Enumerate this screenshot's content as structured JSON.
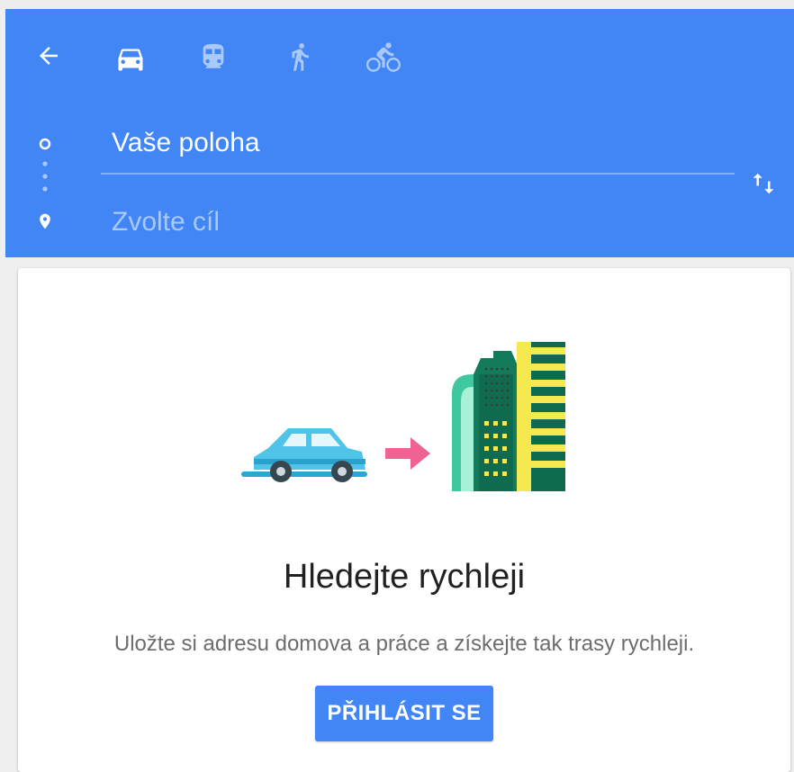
{
  "header": {
    "back_icon": "arrow-back-icon",
    "modes": [
      {
        "name": "driving",
        "icon": "car-icon",
        "selected": true
      },
      {
        "name": "transit",
        "icon": "train-icon",
        "selected": false
      },
      {
        "name": "walking",
        "icon": "walking-icon",
        "selected": false
      },
      {
        "name": "cycling",
        "icon": "bicycle-icon",
        "selected": false
      }
    ],
    "accent_color": "#4285f4"
  },
  "route": {
    "origin_value": "Vaše poloha",
    "destination_placeholder": "Zvolte cíl",
    "swap_icon": "swap-vertical-icon"
  },
  "card": {
    "title": "Hledejte rychleji",
    "subtitle": "Uložte si adresu domova a práce a získejte tak trasy rychleji.",
    "signin_label": "PŘIHLÁSIT SE"
  }
}
